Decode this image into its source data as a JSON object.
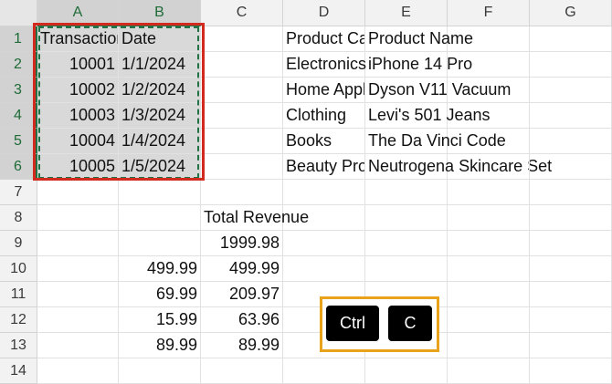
{
  "columns": [
    "A",
    "B",
    "C",
    "D",
    "E",
    "F",
    "G"
  ],
  "rows": [
    "1",
    "2",
    "3",
    "4",
    "5",
    "6",
    "7",
    "8",
    "9",
    "10",
    "11",
    "12",
    "13",
    "14"
  ],
  "cells": {
    "A1": "Transaction ID",
    "B1": "Date",
    "D1": "Product Category",
    "E1": "Product Name",
    "A2": "10001",
    "B2": "1/1/2024",
    "D2": "Electronics",
    "E2": "iPhone 14 Pro",
    "A3": "10002",
    "B3": "1/2/2024",
    "D3": "Home Appliances",
    "E3": "Dyson V11 Vacuum",
    "A4": "10003",
    "B4": "1/3/2024",
    "D4": "Clothing",
    "E4": "Levi's 501 Jeans",
    "A5": "10004",
    "B5": "1/4/2024",
    "D5": "Books",
    "E5": "The Da Vinci Code",
    "A6": "10005",
    "B6": "1/5/2024",
    "D6": "Beauty Products",
    "E6": "Neutrogena Skincare Set",
    "C8": "Total Revenue",
    "C9": "1999.98",
    "B10": "499.99",
    "C10": "499.99",
    "B11": "69.99",
    "C11": "209.97",
    "B12": "15.99",
    "C12": "63.96",
    "B13": "89.99",
    "C13": "89.99"
  },
  "selection": {
    "range": "A1:B6",
    "state": "copied"
  },
  "keys": {
    "ctrl": "Ctrl",
    "c": "C"
  },
  "colors": {
    "copy_border": "#217346",
    "highlight": "#d22a1e",
    "key_frame": "#e8a21c"
  }
}
